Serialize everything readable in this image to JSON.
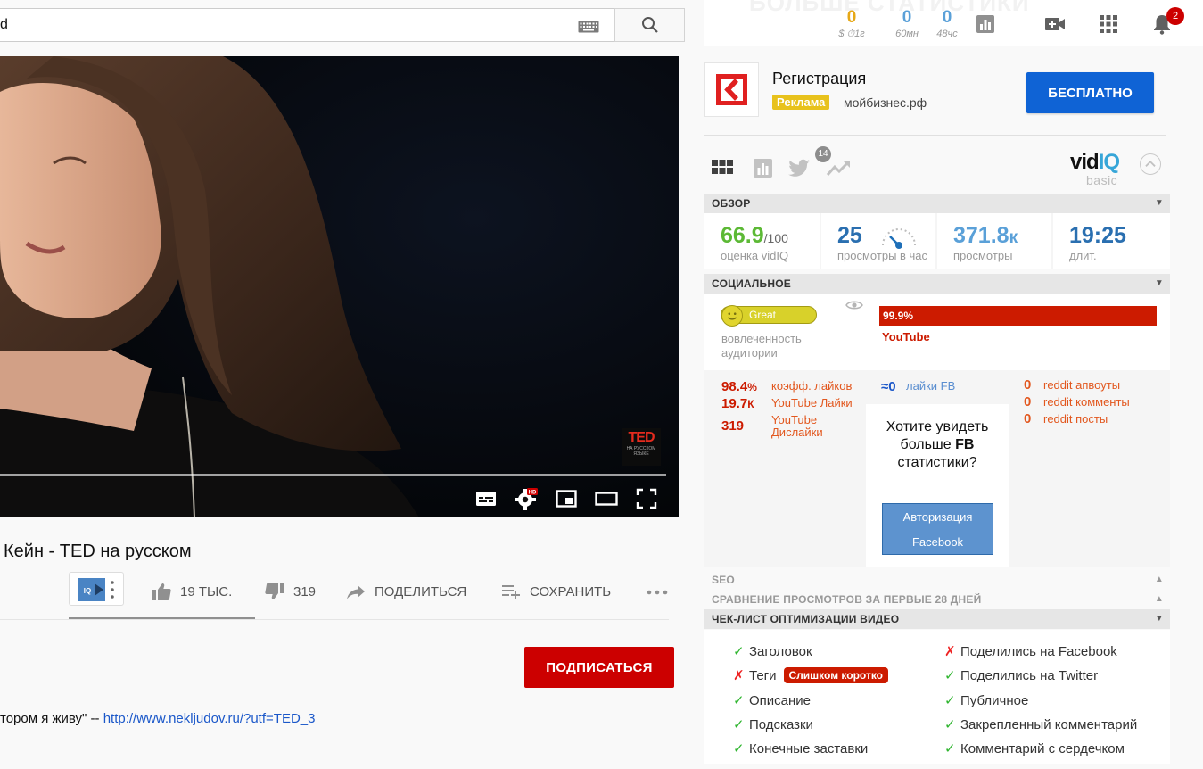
{
  "search": {
    "query": "d"
  },
  "topstats": {
    "banner": "БОЛЬШЕ СТАТИСТИКИ",
    "money_value": "0",
    "money_label": "$ ⏱1г",
    "views60_value": "0",
    "views60_label": "60мн",
    "views48_value": "0",
    "views48_label": "48чс",
    "notifications": "2"
  },
  "video": {
    "ted_logo": "TED",
    "ted_sub": "НА РУССКОМ ЯЗЫКЕ",
    "progress": 1.0,
    "title": "Кейн - TED на русском",
    "likes": "19 ТЫС.",
    "dislikes": "319",
    "share_label": "ПОДЕЛИТЬСЯ",
    "save_label": "СОХРАНИТЬ",
    "like_ratio": 0.984
  },
  "channel": {
    "subscribe_label": "ПОДПИСАТЬСЯ",
    "desc_prefix": "тором я живу\" -- ",
    "desc_link": "http://www.nekljudov.ru/?utf=TED_3"
  },
  "ad": {
    "title": "Регистрация",
    "badge": "Реклама",
    "domain": "мойбизнес.рф",
    "cta": "БЕСПЛАТНО"
  },
  "vidiq": {
    "logo": "vid",
    "logo_accent": "IQ",
    "plan": "basic",
    "twitter_count": "14",
    "sections": {
      "overview": "ОБЗОР",
      "social": "СОЦИАЛЬНОЕ",
      "seo": "SEO",
      "compare": "СРАВНЕНИЕ ПРОСМОТРОВ ЗА ПЕРВЫЕ 28 ДНЕЙ",
      "checklist": "ЧЕК-ЛИСТ ОПТИМИЗАЦИИ ВИДЕО"
    },
    "overview": {
      "score": "66.9",
      "score_max": "/100",
      "score_label": "оценка vidIQ",
      "vph": "25",
      "vph_label": "просмотры в час",
      "views": "371.8",
      "views_unit": "к",
      "views_label": "просмотры",
      "duration": "19:25",
      "duration_label": "длит."
    },
    "social": {
      "engagement": "Great",
      "engagement_label": "вовлеченность аудитории",
      "yt_share": "99.9%",
      "yt_label": "YouTube",
      "like_ratio": "98.4",
      "like_ratio_unit": "%",
      "like_ratio_label": "коэфф. лайков",
      "yt_likes": "19.7",
      "yt_likes_unit": "К",
      "yt_likes_label": "YouTube Лайки",
      "yt_dislikes": "319",
      "yt_dislikes_label": "YouTube Дислайки",
      "fb_likes": "≈0",
      "fb_likes_label": "лайки FB",
      "fb_msg_1": "Хотите увидеть больше ",
      "fb_msg_bold": "FB",
      "fb_msg_2": " статистики?",
      "fb_btn_1": "Авторизация",
      "fb_btn_2": "Facebook",
      "reddit_upvotes": "0",
      "reddit_upvotes_label": "reddit апвоуты",
      "reddit_comments": "0",
      "reddit_comments_label": "reddit комменты",
      "reddit_posts": "0",
      "reddit_posts_label": "reddit посты"
    },
    "checklist": {
      "ok_mark": "✓",
      "bad_mark": "✗",
      "left": [
        {
          "label": "Заголовок",
          "ok": true
        },
        {
          "label": "Теги",
          "ok": false,
          "warning": "Слишком коротко"
        },
        {
          "label": "Описание",
          "ok": true
        },
        {
          "label": "Подсказки",
          "ok": true
        },
        {
          "label": "Конечные заставки",
          "ok": true
        }
      ],
      "right": [
        {
          "label": "Поделились на Facebook",
          "ok": false
        },
        {
          "label": "Поделились на Twitter",
          "ok": true
        },
        {
          "label": "Публичное",
          "ok": true
        },
        {
          "label": "Закрепленный комментарий",
          "ok": true
        },
        {
          "label": "Комментарий с сердечком",
          "ok": true
        }
      ]
    }
  },
  "colors": {
    "youtube_red": "#cc0000",
    "vidiq_blue": "#37a6d8",
    "score_green": "#5cb935",
    "stat_blue": "#2a6fb0",
    "ad_blue": "#0f63d5"
  }
}
